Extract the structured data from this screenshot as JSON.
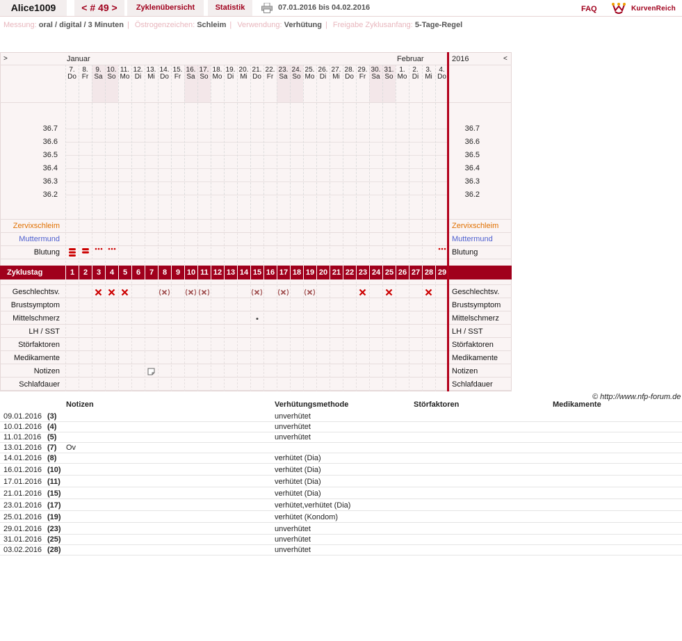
{
  "header": {
    "user": "Alice1009",
    "cycle_nav": "< # 49 >",
    "tab_overview": "Zyklenübersicht",
    "tab_stats": "Statistik",
    "date_range": "07.01.2016 bis 04.02.2016",
    "faq": "FAQ",
    "logo": "KurvenReich"
  },
  "settings": [
    {
      "label": "Messung:",
      "value": "oral / digital / 3 Minuten"
    },
    {
      "label": "Östrogenzeichen:",
      "value": "Schleim"
    },
    {
      "label": "Verwendung:",
      "value": "Verhütung"
    },
    {
      "label": "Freigabe Zyklusanfang:",
      "value": "5-Tage-Regel"
    }
  ],
  "chart": {
    "nav_left": ">",
    "nav_right": "<",
    "year": "2016",
    "month_jan": "Januar",
    "month_feb": "Februar",
    "day_numbers": [
      "7.",
      "8.",
      "9.",
      "10.",
      "11.",
      "12.",
      "13.",
      "14.",
      "15.",
      "16.",
      "17.",
      "18.",
      "19.",
      "20.",
      "21.",
      "22.",
      "23.",
      "24.",
      "25.",
      "26.",
      "27.",
      "28.",
      "29.",
      "30.",
      "31.",
      "1.",
      "2.",
      "3.",
      "4."
    ],
    "weekdays": [
      "Do",
      "Fr",
      "Sa",
      "So",
      "Mo",
      "Di",
      "Mi",
      "Do",
      "Fr",
      "Sa",
      "So",
      "Mo",
      "Di",
      "Mi",
      "Do",
      "Fr",
      "Sa",
      "So",
      "Mo",
      "Di",
      "Mi",
      "Do",
      "Fr",
      "Sa",
      "So",
      "Mo",
      "Di",
      "Mi",
      "Do"
    ],
    "temps": [
      "36.7",
      "36.6",
      "36.5",
      "36.4",
      "36.3",
      "36.2"
    ],
    "row_labels": {
      "zervix": "Zervixschleim",
      "muttermund": "Muttermund",
      "blutung": "Blutung",
      "zyklustag": "Zyklustag",
      "gv": "Geschlechtsv.",
      "brust": "Brustsymptom",
      "mittel": "Mittelschmerz",
      "lh": "LH / SST",
      "stoer": "Störfaktoren",
      "med": "Medikamente",
      "notizen": "Notizen",
      "schlaf": "Schlafdauer"
    },
    "cycle_days": [
      "1",
      "2",
      "3",
      "4",
      "5",
      "6",
      "7",
      "8",
      "9",
      "10",
      "11",
      "12",
      "13",
      "14",
      "15",
      "16",
      "17",
      "18",
      "19",
      "20",
      "21",
      "22",
      "23",
      "24",
      "25",
      "26",
      "27",
      "28",
      "29"
    ],
    "colors": {
      "accent": "#a0001c",
      "zervix": "#e07000",
      "muttermund": "#4d5fcf",
      "weekend": "#f3e7e9"
    }
  },
  "copyright": "© http://www.nfp-forum.de",
  "notes": {
    "headers": {
      "notizen": "Notizen",
      "methode": "Verhütungsmethode",
      "stoer": "Störfaktoren",
      "med": "Medikamente"
    },
    "rows": [
      {
        "date": "09.01.2016",
        "day": "(3)",
        "note": "",
        "method": "unverhütet"
      },
      {
        "date": "10.01.2016",
        "day": "(4)",
        "note": "",
        "method": "unverhütet"
      },
      {
        "date": "11.01.2016",
        "day": "(5)",
        "note": "",
        "method": "unverhütet"
      },
      {
        "date": "13.01.2016",
        "day": "(7)",
        "note": "Ov",
        "method": ""
      },
      {
        "date": "14.01.2016",
        "day": "(8)",
        "note": "",
        "method": "verhütet (Dia)"
      },
      {
        "date": "16.01.2016",
        "day": "(10)",
        "note": "",
        "method": "verhütet (Dia)"
      },
      {
        "date": "17.01.2016",
        "day": "(11)",
        "note": "",
        "method": "verhütet (Dia)"
      },
      {
        "date": "21.01.2016",
        "day": "(15)",
        "note": "",
        "method": "verhütet (Dia)"
      },
      {
        "date": "23.01.2016",
        "day": "(17)",
        "note": "",
        "method": "verhütet,verhütet (Dia)"
      },
      {
        "date": "25.01.2016",
        "day": "(19)",
        "note": "",
        "method": "verhütet (Kondom)"
      },
      {
        "date": "29.01.2016",
        "day": "(23)",
        "note": "",
        "method": "unverhütet"
      },
      {
        "date": "31.01.2016",
        "day": "(25)",
        "note": "",
        "method": "unverhütet"
      },
      {
        "date": "03.02.2016",
        "day": "(28)",
        "note": "",
        "method": "unverhütet"
      }
    ]
  }
}
